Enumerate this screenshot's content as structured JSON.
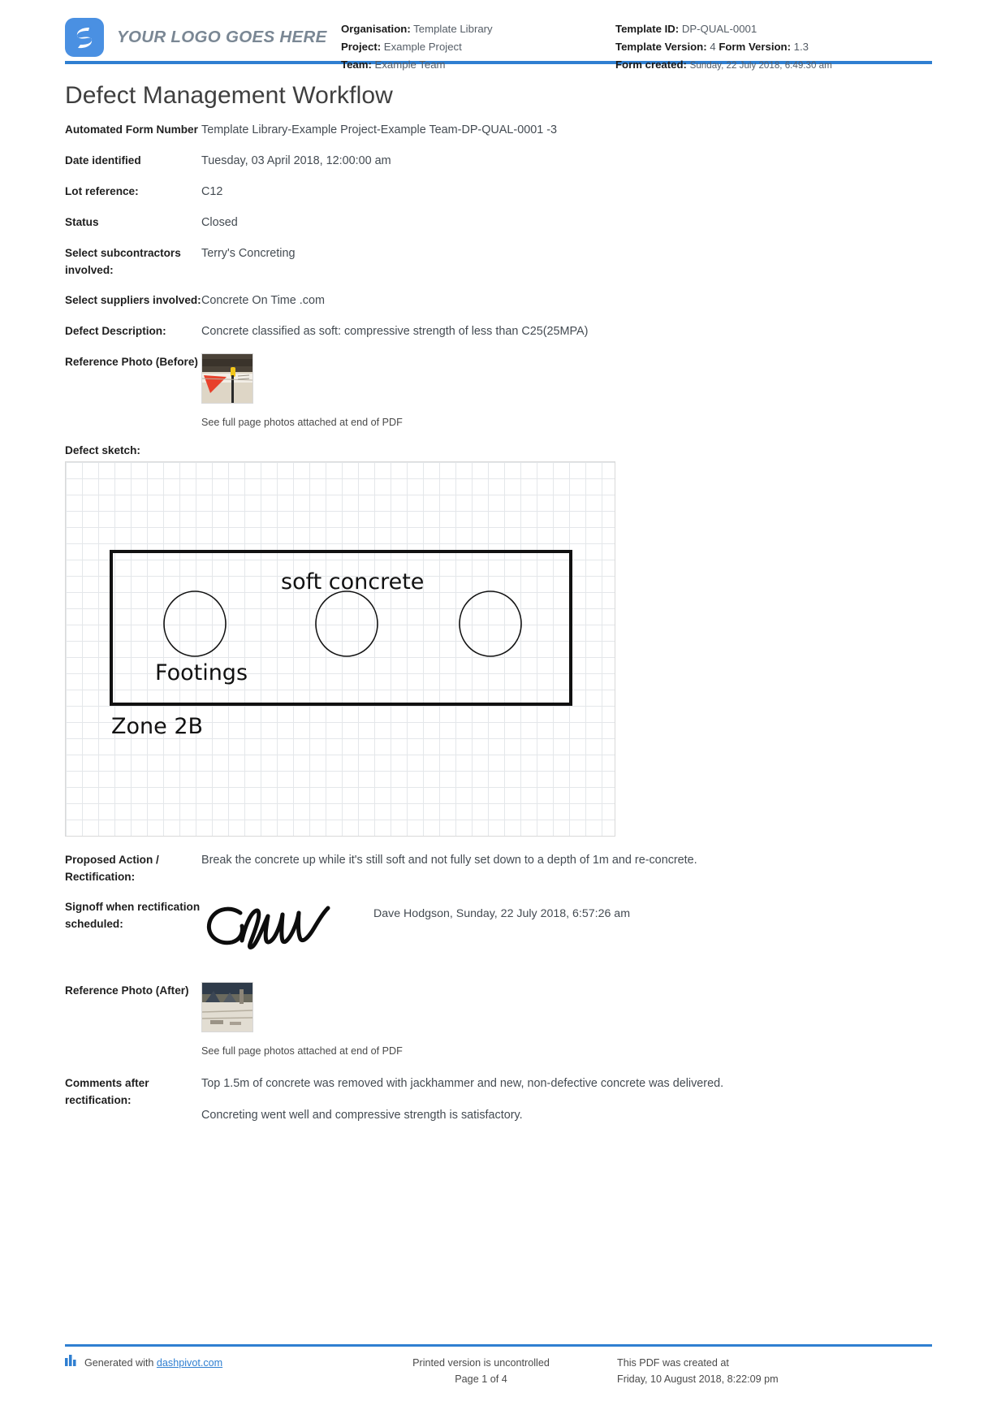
{
  "header": {
    "logo_text": "YOUR LOGO GOES HERE",
    "organisation_label": "Organisation:",
    "organisation_value": "Template Library",
    "project_label": "Project:",
    "project_value": "Example Project",
    "team_label": "Team:",
    "team_value": "Example Team",
    "template_id_label": "Template ID:",
    "template_id_value": "DP-QUAL-0001",
    "template_version_label": "Template Version:",
    "template_version_value": "4",
    "form_version_label": "Form Version:",
    "form_version_value": "1.3",
    "form_created_label": "Form created:",
    "form_created_value": "Sunday, 22 July 2018, 6:49:30 am"
  },
  "title": "Defect Management Workflow",
  "fields": {
    "automated_form_number_label": "Automated Form Number",
    "automated_form_number_value": "Template Library-Example Project-Example Team-DP-QUAL-0001   -3",
    "date_identified_label": "Date identified",
    "date_identified_value": "Tuesday, 03 April 2018, 12:00:00 am",
    "lot_reference_label": "Lot reference:",
    "lot_reference_value": "C12",
    "status_label": "Status",
    "status_value": "Closed",
    "subcontractors_label": "Select subcontractors involved:",
    "subcontractors_value": "Terry's Concreting",
    "suppliers_label": "Select suppliers involved:",
    "suppliers_value": "Concrete On Time .com",
    "defect_description_label": "Defect Description:",
    "defect_description_value": "Concrete classified as soft: compressive strength of less than C25(25MPA)",
    "reference_photo_before_label": "Reference Photo (Before)",
    "photo_caption_before": "See full page photos attached at end of PDF",
    "defect_sketch_label": "Defect sketch:",
    "proposed_action_label": "Proposed Action / Rectification:",
    "proposed_action_value": "Break the concrete up while it's still soft and not fully set down to a depth of 1m and re-concrete.",
    "signoff_label": "Signoff when rectification scheduled:",
    "signoff_value": "Dave Hodgson, Sunday, 22 July 2018, 6:57:26 am",
    "reference_photo_after_label": "Reference Photo (After)",
    "photo_caption_after": "See full page photos attached at end of PDF",
    "comments_label": "Comments after rectification:",
    "comments_line_1": "Top 1.5m of concrete was removed with jackhammer and new, non-defective concrete was delivered.",
    "comments_line_2": "Concreting went well and compressive strength is satisfactory."
  },
  "sketch": {
    "annotation_top": "soft concrete",
    "annotation_footings": "Footings",
    "annotation_zone": "Zone 2B"
  },
  "footer": {
    "generated_prefix": "Generated with ",
    "generated_link": "dashpivot.com",
    "printed_note": "Printed version is uncontrolled",
    "page_number": "Page 1 of 4",
    "created_note": "This PDF was created at",
    "created_date": "Friday, 10 August 2018, 8:22:09 pm"
  },
  "colors": {
    "accent_blue": "#2f7fd1",
    "logo_blue": "#4a90e2"
  }
}
